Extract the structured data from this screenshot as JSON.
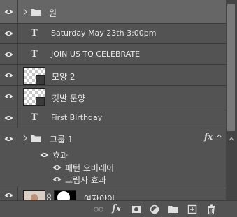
{
  "layers": {
    "items": [
      {
        "name": "원"
      },
      {
        "name": "Saturday May 23th 3:00pm"
      },
      {
        "name": "JOIN US TO CELEBRATE"
      },
      {
        "name": "모양 2"
      },
      {
        "name": "깃발 문양"
      },
      {
        "name": "First Birthday"
      },
      {
        "name": "그룹 1",
        "fx": "fx"
      },
      {
        "name": "효과"
      },
      {
        "name": "패턴 오버레이"
      },
      {
        "name": "그림자 효과"
      },
      {
        "name": "여자아이"
      }
    ]
  },
  "text_layer_glyph": "T",
  "footer": {
    "icons": [
      "link-layers-icon",
      "fx-icon",
      "add-mask-icon",
      "adjustment-layer-icon",
      "new-group-icon",
      "new-layer-icon",
      "delete-layer-icon"
    ],
    "fx_label": "fx"
  },
  "colors": {
    "panel_bg": "#535353",
    "selected_row": "#666666",
    "scroll_thumb": "#797979"
  }
}
